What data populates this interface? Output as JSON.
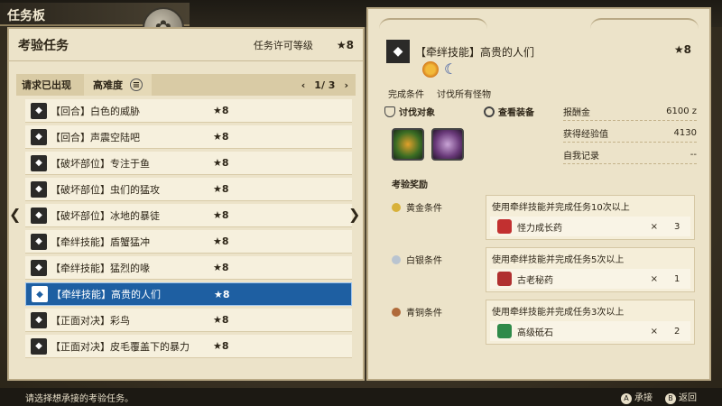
{
  "header": {
    "title": "任务板"
  },
  "left": {
    "category": "考验任务",
    "permit_label": "任务许可等级",
    "permit_stars": "★8",
    "filter": {
      "status": "请求已出现",
      "sort": "高难度",
      "page": "1/ 3"
    },
    "quests": [
      {
        "name": "【回合】白色的威胁",
        "stars": "★8"
      },
      {
        "name": "【回合】声震空陆吧",
        "stars": "★8"
      },
      {
        "name": "【破坏部位】专注于鱼",
        "stars": "★8"
      },
      {
        "name": "【破坏部位】虫们的猛攻",
        "stars": "★8"
      },
      {
        "name": "【破坏部位】冰地的暴徒",
        "stars": "★8"
      },
      {
        "name": "【牵绊技能】盾蟹猛冲",
        "stars": "★8"
      },
      {
        "name": "【牵绊技能】猛烈的喙",
        "stars": "★8"
      },
      {
        "name": "【牵绊技能】高贵的人们",
        "stars": "★8"
      },
      {
        "name": "【正面对决】彩鸟",
        "stars": "★8"
      },
      {
        "name": "【正面对决】皮毛覆盖下的暴力",
        "stars": "★8"
      }
    ]
  },
  "detail": {
    "name": "【牵绊技能】高贵的人们",
    "stars": "★8",
    "completion_label": "完成条件",
    "completion_value": "讨伐所有怪物",
    "targets_title": "讨伐对象",
    "view_equipment": "查看装备",
    "stats": [
      {
        "label": "报酬金",
        "value": "6100 z"
      },
      {
        "label": "获得经验值",
        "value": "4130"
      },
      {
        "label": "自我记录",
        "value": "--"
      }
    ],
    "rewards_title": "考验奖励",
    "times_sign": "×",
    "rewards": [
      {
        "tier": "黄金条件",
        "condition": "使用牵绊技能并完成任务10次以上",
        "item": "怪力成长药",
        "qty": "3"
      },
      {
        "tier": "白银条件",
        "condition": "使用牵绊技能并完成任务5次以上",
        "item": "古老秘药",
        "qty": "1"
      },
      {
        "tier": "青铜条件",
        "condition": "使用牵绊技能并完成任务3次以上",
        "item": "高级砥石",
        "qty": "2"
      }
    ]
  },
  "footer": {
    "hint": "请选择想承接的考验任务。",
    "accept_key": "A",
    "accept": "承接",
    "back_key": "B",
    "back": "返回"
  }
}
